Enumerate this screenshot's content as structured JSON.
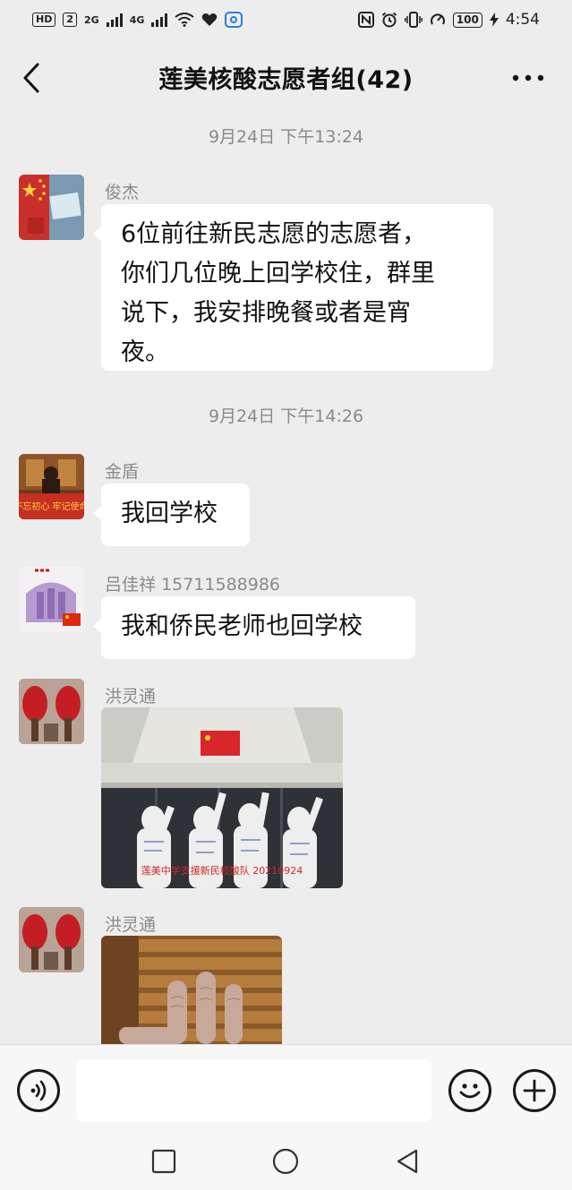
{
  "status_bar": {
    "hd_chip": "HD",
    "sim_num": "2",
    "net1": "2G",
    "net2": "4G",
    "battery": "100",
    "time": "4:54"
  },
  "header": {
    "title": "莲美核酸志愿者组(42)",
    "back_icon": "chevron-left-icon",
    "more_icon": "more-dots-icon"
  },
  "messages": {
    "ts1": "9月24日 下午13:24",
    "ts2": "9月24日 下午14:26",
    "m1": {
      "sender": "俊杰",
      "lines": [
        "6位前往新民志愿的志愿者，",
        "你们几位晚上回学校住，群里",
        "说下，我安排晚餐或者是宵",
        "夜。"
      ]
    },
    "m2": {
      "sender": "金盾",
      "text": "我回学校",
      "avatar_text": "不忘初心 牢记使命"
    },
    "m3": {
      "sender": "吕佳祥 15711588986",
      "text": "我和侨民老师也回学校"
    },
    "m4": {
      "sender": "洪灵通",
      "photo_caption": "莲美中学支援新民核酸队 20210924"
    },
    "m5": {
      "sender": "洪灵通"
    }
  },
  "input_bar": {
    "placeholder": "",
    "voice_icon": "voice-icon",
    "emoji_icon": "emoji-icon",
    "plus_icon": "plus-icon"
  },
  "colors": {
    "background": "#ededed",
    "bubble": "#ffffff",
    "meta_text": "#8a8a8a"
  }
}
